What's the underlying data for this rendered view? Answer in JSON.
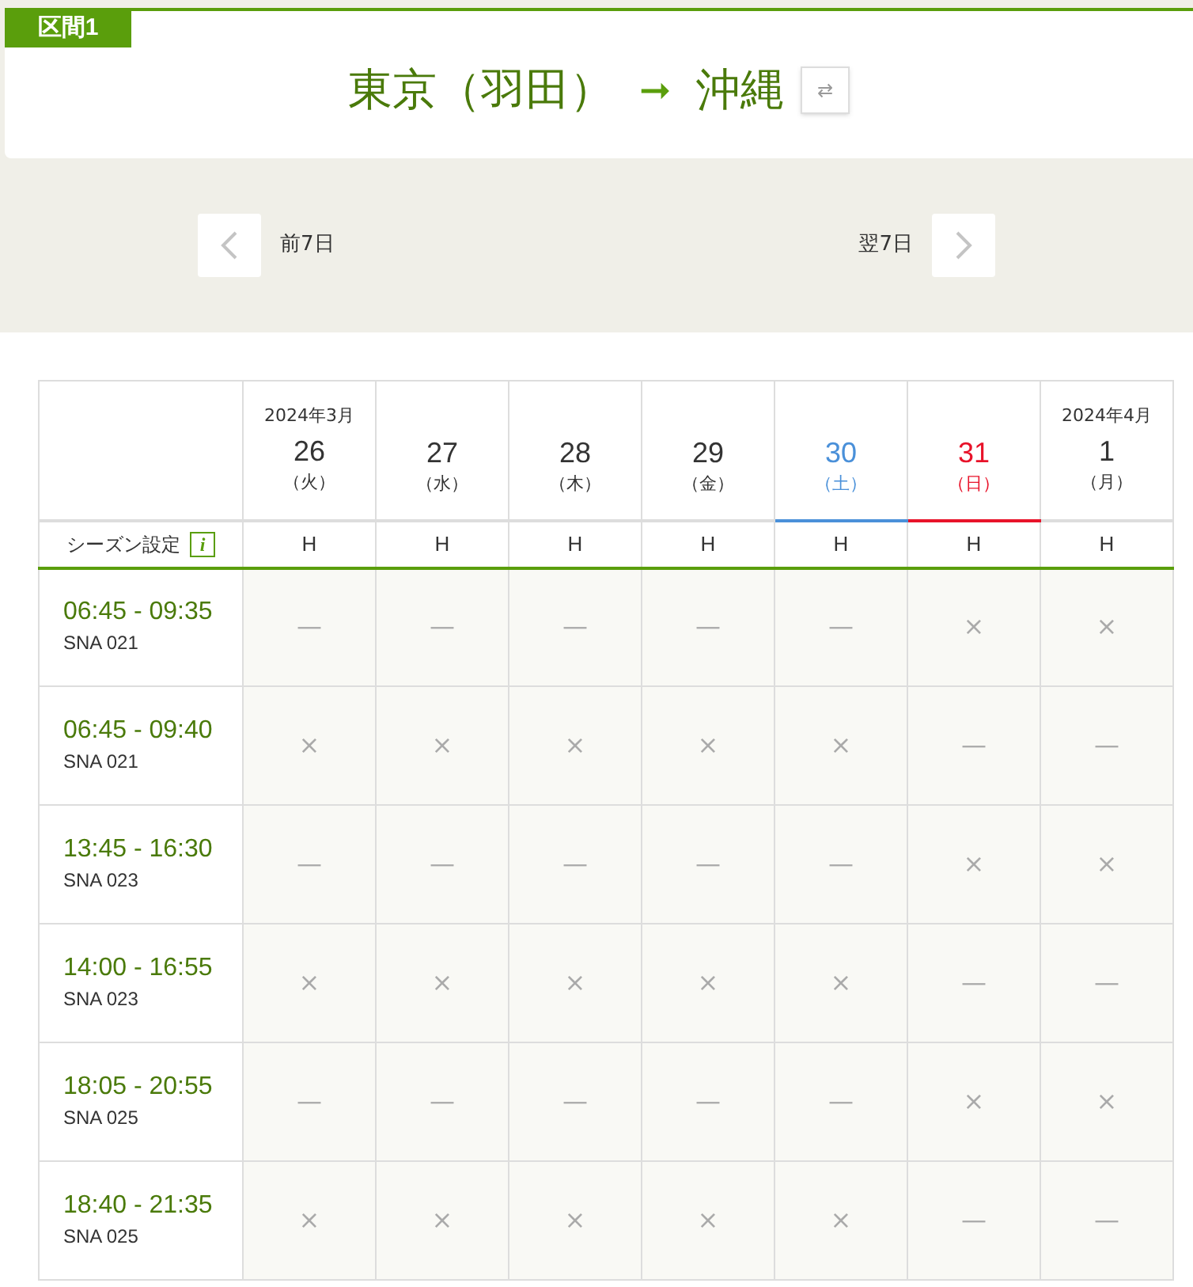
{
  "segment": {
    "label": "区間1",
    "origin": "東京（羽田）",
    "arrow": "➞",
    "destination": "沖縄",
    "swap": "⇄"
  },
  "nav": {
    "prev": "前7日",
    "next": "翌7日"
  },
  "season_label": "シーズン設定",
  "season_info": "i",
  "days": [
    {
      "month": "2024年3月",
      "date": "26",
      "weekday": "（火）",
      "kind": "weekday",
      "season": "H"
    },
    {
      "date": "27",
      "weekday": "（水）",
      "kind": "weekday",
      "season": "H"
    },
    {
      "date": "28",
      "weekday": "（木）",
      "kind": "weekday",
      "season": "H"
    },
    {
      "date": "29",
      "weekday": "（金）",
      "kind": "weekday",
      "season": "H"
    },
    {
      "date": "30",
      "weekday": "（土）",
      "kind": "saturday",
      "season": "H"
    },
    {
      "date": "31",
      "weekday": "（日）",
      "kind": "sunday",
      "season": "H"
    },
    {
      "month": "2024年4月",
      "date": "1",
      "weekday": "（月）",
      "kind": "weekday",
      "season": "H"
    }
  ],
  "flights": [
    {
      "time": "06:45 - 09:35",
      "number": "SNA 021",
      "cells": [
        "—",
        "—",
        "—",
        "—",
        "—",
        "×",
        "×"
      ]
    },
    {
      "time": "06:45 - 09:40",
      "number": "SNA 021",
      "cells": [
        "×",
        "×",
        "×",
        "×",
        "×",
        "—",
        "—"
      ]
    },
    {
      "time": "13:45 - 16:30",
      "number": "SNA 023",
      "cells": [
        "—",
        "—",
        "—",
        "—",
        "—",
        "×",
        "×"
      ]
    },
    {
      "time": "14:00 - 16:55",
      "number": "SNA 023",
      "cells": [
        "×",
        "×",
        "×",
        "×",
        "×",
        "—",
        "—"
      ]
    },
    {
      "time": "18:05 - 20:55",
      "number": "SNA 025",
      "cells": [
        "—",
        "—",
        "—",
        "—",
        "—",
        "×",
        "×"
      ]
    },
    {
      "time": "18:40 - 21:35",
      "number": "SNA 025",
      "cells": [
        "×",
        "×",
        "×",
        "×",
        "×",
        "—",
        "—"
      ]
    }
  ]
}
